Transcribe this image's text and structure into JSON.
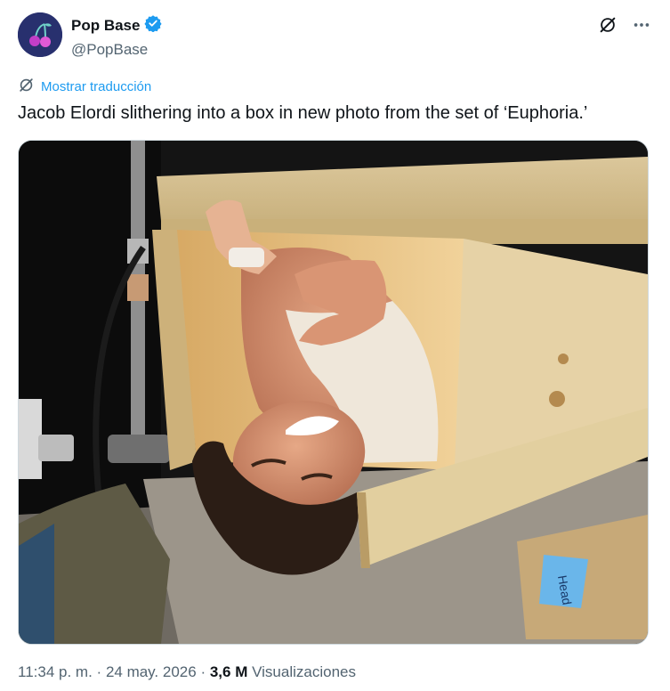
{
  "author": {
    "display_name": "Pop Base",
    "handle": "@PopBase",
    "verified": true,
    "avatar_icon": "cherries-avatar-icon",
    "accent_color": "#1d9bf0"
  },
  "actions": {
    "grok_icon": "grok-icon",
    "more_icon": "more-icon"
  },
  "translate_link": "Mostrar traducción",
  "tweet_text": "Jacob Elordi slithering into a box in new photo from the set of ‘Euphoria.’",
  "media": {
    "type": "photo",
    "tape_label": "Head"
  },
  "meta": {
    "time": "11:34 p. m.",
    "separator": "·",
    "date": "24 may. 2026",
    "views_count": "3,6 M",
    "views_label": "Visualizaciones"
  }
}
